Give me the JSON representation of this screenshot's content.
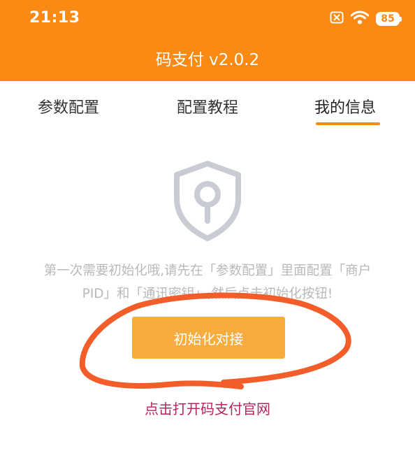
{
  "status_bar": {
    "time": "21:13",
    "battery": "85",
    "icons": [
      "sim-off-icon",
      "wifi-icon",
      "battery-icon"
    ]
  },
  "header": {
    "title": "码支付 v2.0.2"
  },
  "tabs": [
    {
      "label": "参数配置",
      "active": false
    },
    {
      "label": "配置教程",
      "active": false
    },
    {
      "label": "我的信息",
      "active": true
    }
  ],
  "main": {
    "icon": "shield-keyhole-icon",
    "notice_line1": "第一次需要初始化哦,请先在「参数配置」里面配置「商户",
    "notice_line2": "PID」和「通讯密钥」,然后点击初始化按钮!",
    "init_button_label": "初始化对接",
    "site_link_label": "点击打开码支付官网"
  },
  "colors": {
    "primary": "#fa8a14",
    "button": "#f9ac3e",
    "link": "#b5245d",
    "annotation": "#f25d2a",
    "notice_text": "#b9b9b9"
  }
}
